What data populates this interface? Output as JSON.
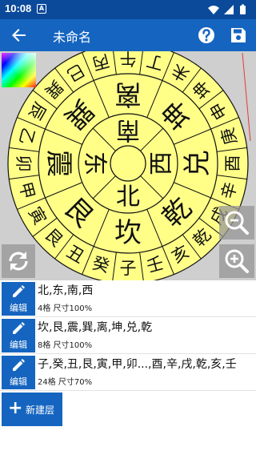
{
  "status": {
    "time": "10:08",
    "notification_badge": "A"
  },
  "header": {
    "title": "未命名",
    "back_icon": "arrow-back-icon",
    "help_icon": "help-circle-icon",
    "save_icon": "save-icon",
    "bar_color": "#1565c0"
  },
  "compass": {
    "center_color": "#ffff88",
    "ring1": [
      "北",
      "东",
      "南",
      "西"
    ],
    "ring2": [
      "坎",
      "艮",
      "震",
      "巽",
      "离",
      "坤",
      "兑",
      "乾"
    ],
    "ring3": [
      "子",
      "癸",
      "丑",
      "艮",
      "寅",
      "甲",
      "卯",
      "乙",
      "辰",
      "巽",
      "巳",
      "丙",
      "午",
      "丁",
      "未",
      "坤",
      "申",
      "庚",
      "酉",
      "辛",
      "戌",
      "乾",
      "亥",
      "壬"
    ]
  },
  "controls": {
    "zoom_out_icon": "zoom-out-icon",
    "zoom_in_icon": "zoom-in-icon",
    "rotate_icon": "rotate-icon",
    "palette_icon": "color-palette-icon"
  },
  "layers": [
    {
      "name": "北,东,南,西",
      "info": "4格   尺寸100%",
      "edit_label": "编辑"
    },
    {
      "name": "坎,艮,震,巽,离,坤,兑,乾",
      "info": "8格   尺寸100%",
      "edit_label": "编辑"
    },
    {
      "name": "子,癸,丑,艮,寅,甲,卯...,酉,辛,戌,乾,亥,壬",
      "info": "24格   尺寸70%",
      "edit_label": "编辑"
    }
  ],
  "new_layer": {
    "label": "新建层"
  }
}
